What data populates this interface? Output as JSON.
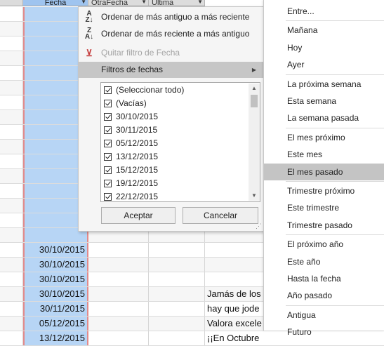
{
  "grid": {
    "headers": [
      "Fecha",
      "OtraFecha",
      "Última"
    ],
    "date_cells": [
      "30/10/2015",
      "30/10/2015",
      "30/10/2015",
      "30/10/2015",
      "30/11/2015",
      "05/12/2015",
      "13/12/2015"
    ],
    "text_cells": [
      "",
      "",
      "",
      "Jamás de los",
      "hay que jode",
      "Valora excele",
      "¡¡En Octubre"
    ]
  },
  "filter_menu": {
    "sort_asc": "Ordenar de más antiguo a más reciente",
    "sort_desc": "Ordenar de más reciente a más antiguo",
    "clear_filter": "Quitar filtro de Fecha",
    "date_filters": "Filtros de fechas",
    "list_items": [
      {
        "label": "(Seleccionar todo)",
        "checked": true
      },
      {
        "label": "(Vacías)",
        "checked": true
      },
      {
        "label": "30/10/2015",
        "checked": true
      },
      {
        "label": "30/11/2015",
        "checked": true
      },
      {
        "label": "05/12/2015",
        "checked": true
      },
      {
        "label": "13/12/2015",
        "checked": true
      },
      {
        "label": "15/12/2015",
        "checked": true
      },
      {
        "label": "19/12/2015",
        "checked": true
      },
      {
        "label": "22/12/2015",
        "checked": true
      }
    ],
    "ok_button": "Aceptar",
    "cancel_button": "Cancelar"
  },
  "date_submenu": {
    "groups": [
      [
        "Entre..."
      ],
      [
        "Mañana",
        "Hoy",
        "Ayer"
      ],
      [
        "La próxima semana",
        "Esta semana",
        "La semana pasada"
      ],
      [
        "El mes próximo",
        "Este mes",
        "El mes pasado"
      ],
      [
        "Trimestre próximo",
        "Este trimestre",
        "Trimestre pasado"
      ],
      [
        "El próximo año",
        "Este año",
        "Hasta la fecha",
        "Año pasado"
      ],
      [
        "Antigua",
        "Futuro"
      ]
    ],
    "highlighted": "El mes pasado"
  },
  "colors": {
    "selected_column": "#b7d5f5",
    "column_border": "#e38a8a",
    "highlight": "#c6c6c6"
  }
}
